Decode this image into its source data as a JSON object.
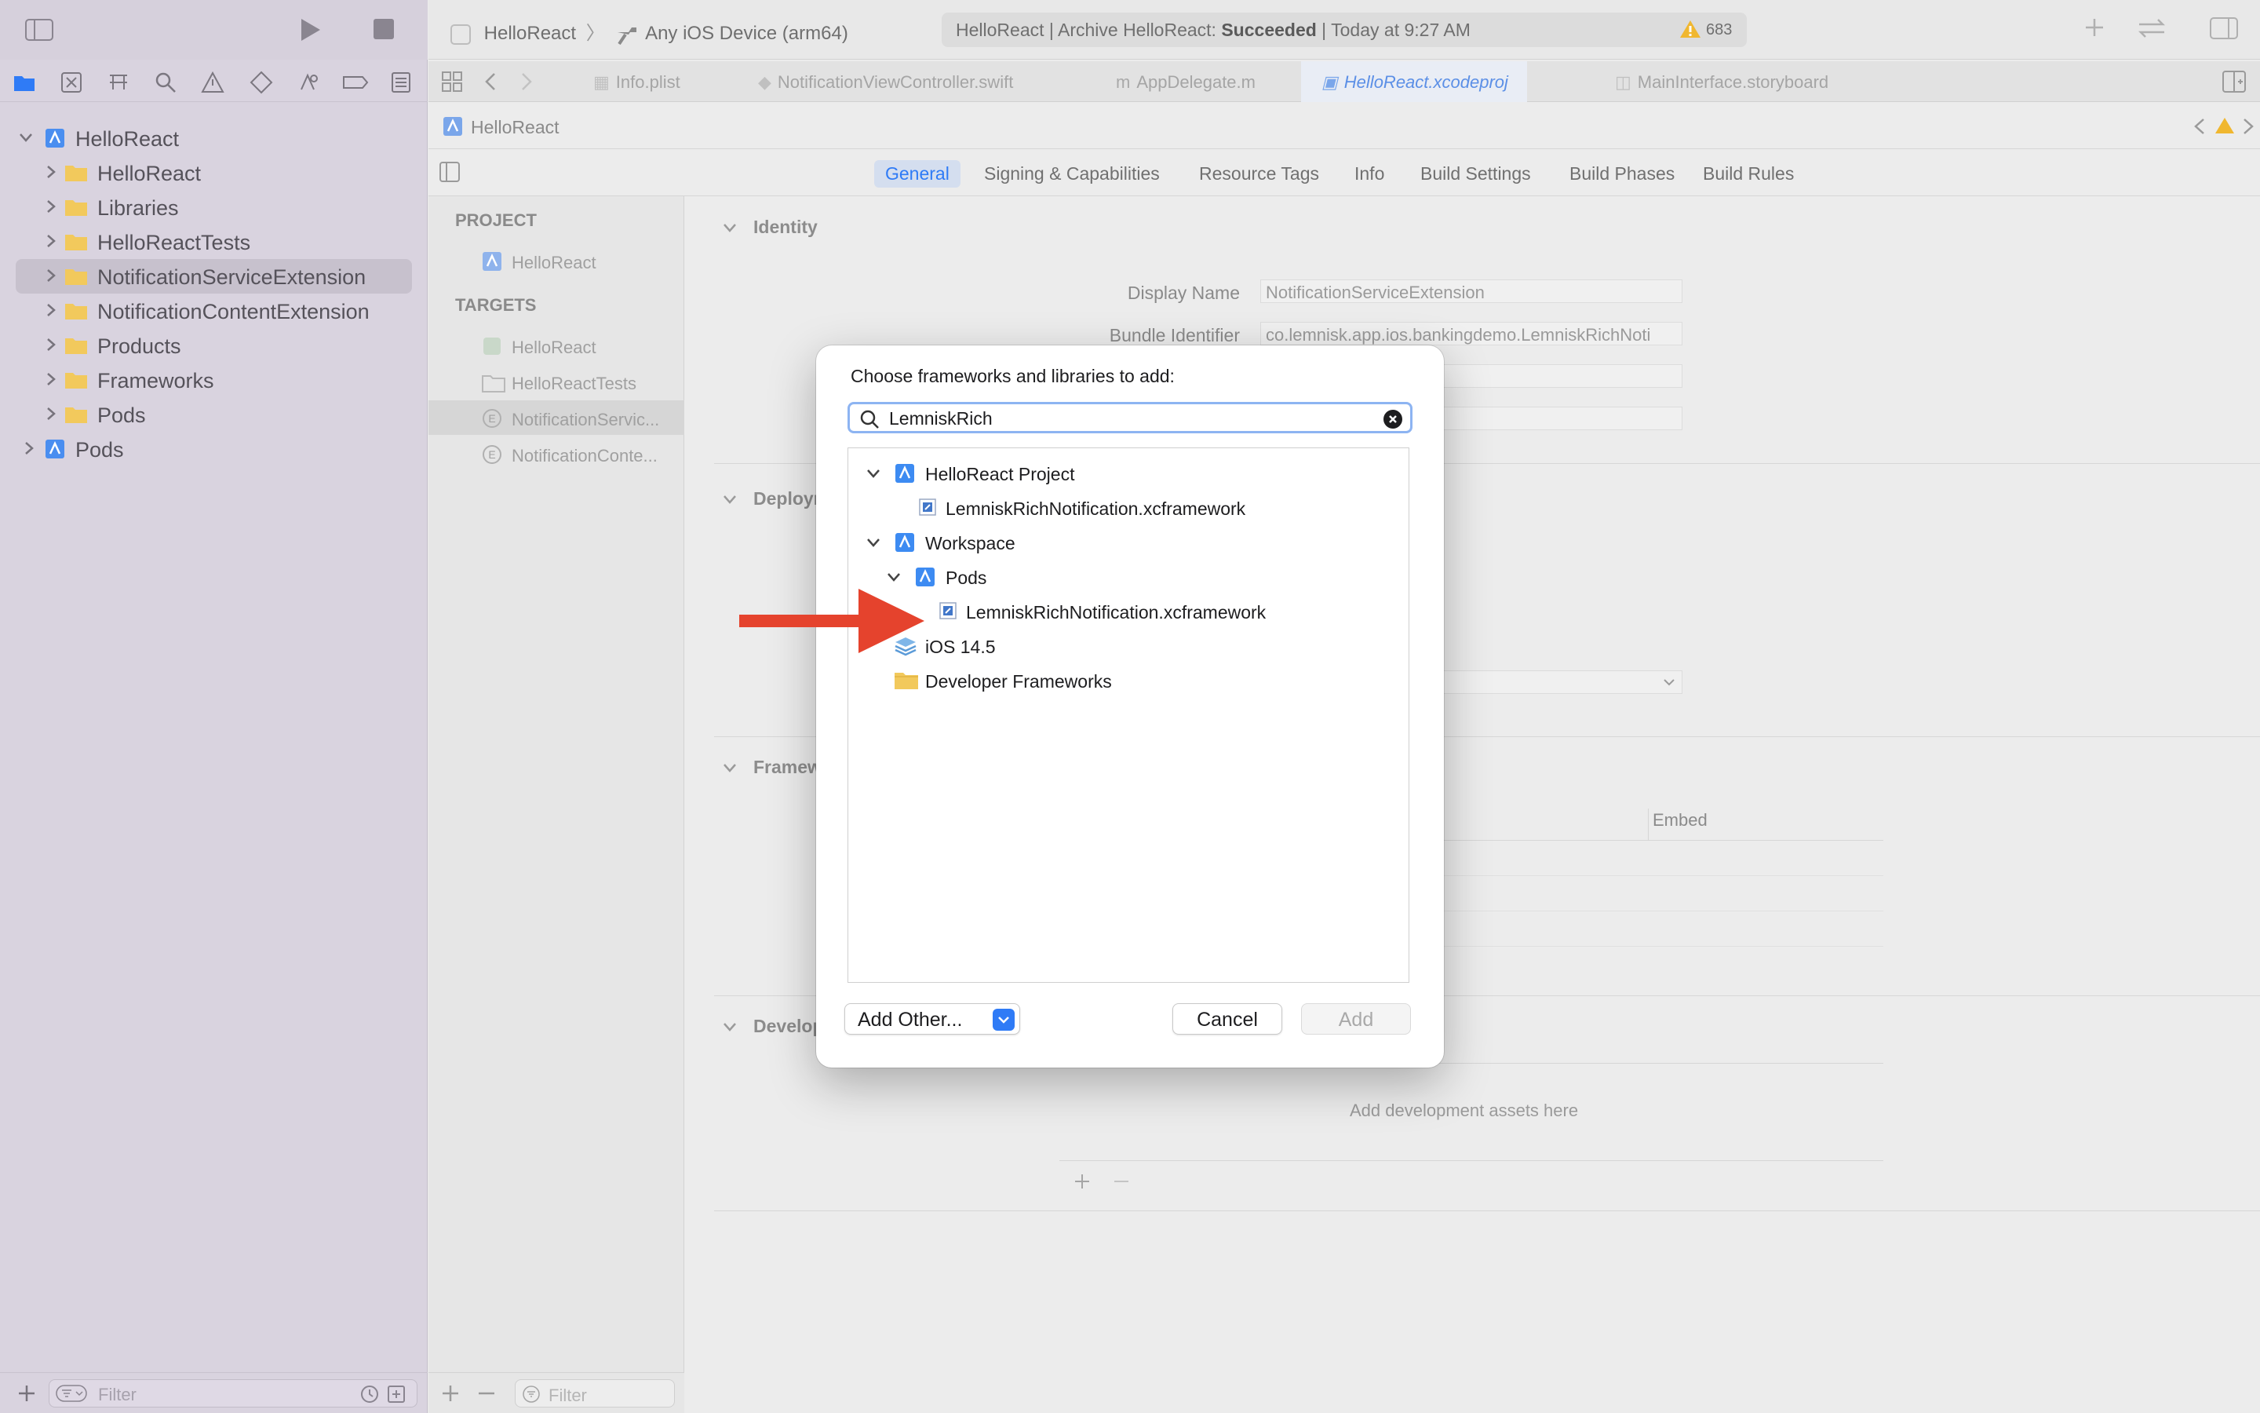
{
  "sidebar": {
    "items": [
      {
        "label": "HelloReact",
        "icon": "project-icon"
      },
      {
        "label": "HelloReact",
        "icon": "folder-icon"
      },
      {
        "label": "Libraries",
        "icon": "folder-icon"
      },
      {
        "label": "HelloReactTests",
        "icon": "folder-icon"
      },
      {
        "label": "NotificationServiceExtension",
        "icon": "folder-icon"
      },
      {
        "label": "NotificationContentExtension",
        "icon": "folder-icon"
      },
      {
        "label": "Products",
        "icon": "folder-icon"
      },
      {
        "label": "Frameworks",
        "icon": "folder-icon"
      },
      {
        "label": "Pods",
        "icon": "folder-icon"
      },
      {
        "label": "Pods",
        "icon": "project-icon"
      }
    ],
    "filter_placeholder": "Filter"
  },
  "toolbar": {
    "scheme": "HelloReact",
    "destination": "Any iOS Device (arm64)",
    "activity_prefix": "HelloReact | Archive HelloReact: ",
    "activity_status": "Succeeded",
    "activity_time": " | Today at 9:27 AM",
    "warning_count": "683"
  },
  "tabs": [
    {
      "label": "Info.plist"
    },
    {
      "label": "NotificationViewController.swift"
    },
    {
      "label": "AppDelegate.m"
    },
    {
      "label": "HelloReact.xcodeproj"
    },
    {
      "label": "MainInterface.storyboard"
    }
  ],
  "jumpbar": {
    "label": "HelloReact"
  },
  "editor_tabs": [
    {
      "label": "General"
    },
    {
      "label": "Signing & Capabilities"
    },
    {
      "label": "Resource Tags"
    },
    {
      "label": "Info"
    },
    {
      "label": "Build Settings"
    },
    {
      "label": "Build Phases"
    },
    {
      "label": "Build Rules"
    }
  ],
  "targets_list": {
    "project_header": "PROJECT",
    "project_item": "HelloReact",
    "targets_header": "TARGETS",
    "targets": [
      "HelloReact",
      "HelloReactTests",
      "NotificationServic...",
      "NotificationConte..."
    ],
    "filter_placeholder": "Filter"
  },
  "content": {
    "identity_title": "Identity",
    "display_name_label": "Display Name",
    "display_name_value": "NotificationServiceExtension",
    "bundle_id_label": "Bundle Identifier",
    "bundle_id_value": "co.lemnisk.app.ios.bankingdemo.LemniskRichNoti",
    "deployment_title": "Deploym",
    "frameworks_title": "Framew",
    "embed_header": "Embed",
    "development_title": "Develop",
    "dev_assets_hint": "Add development assets here"
  },
  "dialog": {
    "title": "Choose frameworks and libraries to add:",
    "search_value": "LemniskRich",
    "items": [
      {
        "label": "HelloReact Project"
      },
      {
        "label": "LemniskRichNotification.xcframework"
      },
      {
        "label": "Workspace"
      },
      {
        "label": "Pods"
      },
      {
        "label": "LemniskRichNotification.xcframework"
      },
      {
        "label": "iOS 14.5"
      },
      {
        "label": "Developer Frameworks"
      }
    ],
    "add_other_label": "Add Other...",
    "cancel_label": "Cancel",
    "add_label": "Add"
  },
  "colors": {
    "accent": "#2f7bf6",
    "arrow": "#e5432d",
    "folder": "#f2c95c"
  }
}
